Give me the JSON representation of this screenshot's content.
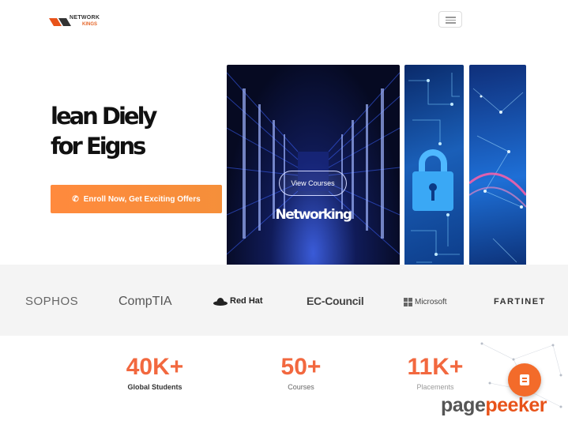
{
  "header": {
    "logo_line1": "NETWORK",
    "logo_line2": "KINGS"
  },
  "hero": {
    "title_line1": "lean Diely",
    "title_line2": "for Eigns",
    "enroll_label": "Enroll Now, Get Exciting Offers"
  },
  "cards": {
    "main_title": "Networking",
    "view_label": "View Courses"
  },
  "partners": [
    "SOPHOS",
    "CompTIA",
    "Red Hat",
    "EC-Council",
    "Microsoft",
    "FARTINET"
  ],
  "stats": [
    {
      "value": "40K+",
      "label": "Global Students"
    },
    {
      "value": "50+",
      "label": "Courses"
    },
    {
      "value": "11K+",
      "label": "Placements"
    }
  ],
  "watermark": {
    "part1": "page",
    "part2": "peeker"
  },
  "colors": {
    "accent": "#f2683f",
    "button": "#ff8a3d",
    "band": "#f4f4f4"
  },
  "icons": {
    "menu": "hamburger-icon",
    "phone": "phone-icon",
    "chat": "chat-icon",
    "redhat": "redhat-hat-icon",
    "microsoft": "microsoft-grid-icon"
  }
}
